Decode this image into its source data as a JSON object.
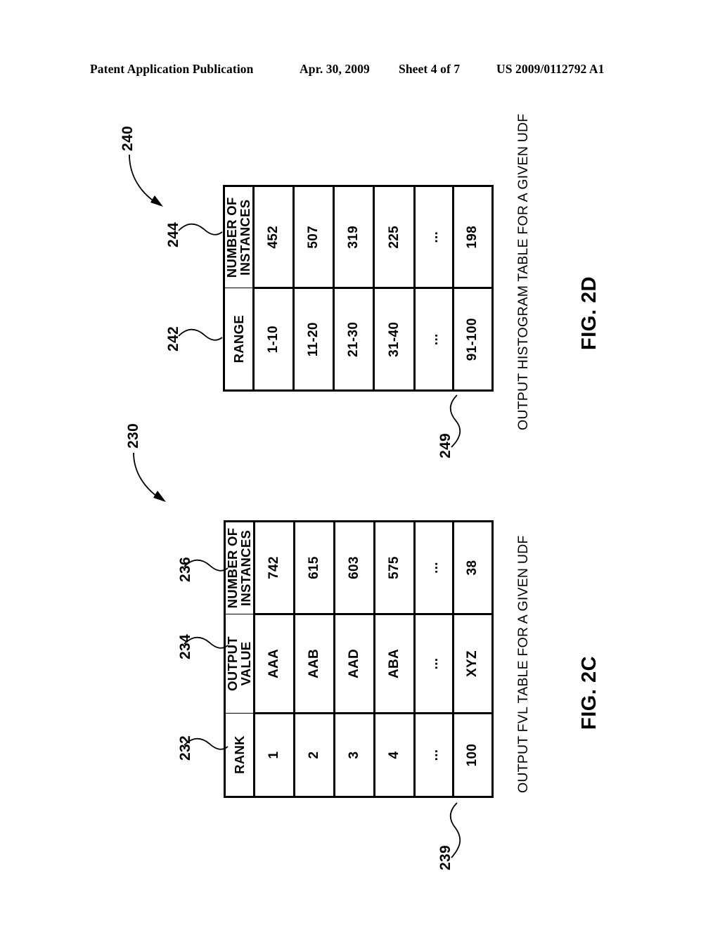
{
  "header": {
    "publication": "Patent Application Publication",
    "date": "Apr. 30, 2009",
    "sheet": "Sheet 4 of 7",
    "patent_number": "US 2009/0112792 A1"
  },
  "figures": [
    {
      "id": "fig-2d",
      "label": "FIG. 2D",
      "caption": "OUTPUT HISTOGRAM TABLE FOR A GIVEN UDF",
      "figure_ref": "240",
      "table_ref": "249",
      "column_refs": [
        "242",
        "244"
      ],
      "columns": [
        "RANGE",
        "NUMBER OF INSTANCES"
      ],
      "rows": [
        {
          "range": "1-10",
          "instances": "452"
        },
        {
          "range": "11-20",
          "instances": "507"
        },
        {
          "range": "21-30",
          "instances": "319"
        },
        {
          "range": "31-40",
          "instances": "225"
        },
        {
          "range": "...",
          "instances": "..."
        },
        {
          "range": "91-100",
          "instances": "198"
        }
      ]
    },
    {
      "id": "fig-2c",
      "label": "FIG. 2C",
      "caption": "OUTPUT FVL TABLE FOR A GIVEN UDF",
      "figure_ref": "230",
      "table_ref": "239",
      "column_refs": [
        "232",
        "234",
        "236"
      ],
      "columns": [
        "RANK",
        "OUTPUT VALUE",
        "NUMBER OF INSTANCES"
      ],
      "rows": [
        {
          "rank": "1",
          "output_value": "AAA",
          "instances": "742"
        },
        {
          "rank": "2",
          "output_value": "AAB",
          "instances": "615"
        },
        {
          "rank": "3",
          "output_value": "AAD",
          "instances": "603"
        },
        {
          "rank": "4",
          "output_value": "ABA",
          "instances": "575"
        },
        {
          "rank": "...",
          "output_value": "...",
          "instances": "..."
        },
        {
          "rank": "100",
          "output_value": "XYZ",
          "instances": "38"
        }
      ]
    }
  ],
  "chart_data": {
    "type": "table",
    "title": "Patent figures 2C and 2D - UDF output tables",
    "tables": [
      {
        "name": "OUTPUT HISTOGRAM TABLE FOR A GIVEN UDF",
        "figure": "FIG. 2D",
        "reference": "240",
        "columns": [
          "RANGE",
          "NUMBER OF INSTANCES"
        ],
        "rows": [
          [
            "1-10",
            "452"
          ],
          [
            "11-20",
            "507"
          ],
          [
            "21-30",
            "319"
          ],
          [
            "31-40",
            "225"
          ],
          [
            "...",
            "..."
          ],
          [
            "91-100",
            "198"
          ]
        ]
      },
      {
        "name": "OUTPUT FVL TABLE FOR A GIVEN UDF",
        "figure": "FIG. 2C",
        "reference": "230",
        "columns": [
          "RANK",
          "OUTPUT VALUE",
          "NUMBER OF INSTANCES"
        ],
        "rows": [
          [
            "1",
            "AAA",
            "742"
          ],
          [
            "2",
            "AAB",
            "615"
          ],
          [
            "3",
            "AAD",
            "603"
          ],
          [
            "4",
            "ABA",
            "575"
          ],
          [
            "...",
            "...",
            "..."
          ],
          [
            "100",
            "XYZ",
            "38"
          ]
        ]
      }
    ]
  }
}
